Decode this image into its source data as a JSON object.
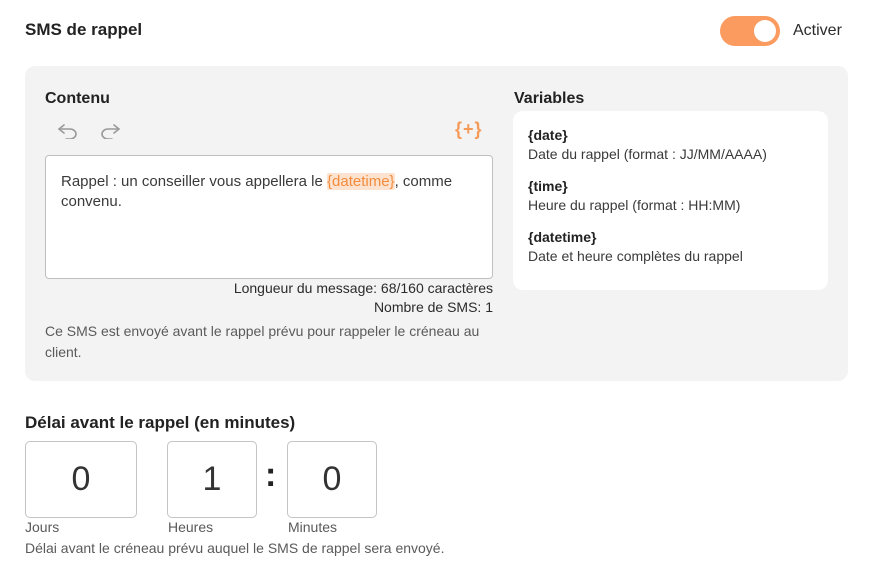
{
  "header": {
    "title": "SMS de rappel",
    "toggle_label": "Activer",
    "toggle_on": true,
    "accent_color": "#fb9b5f"
  },
  "content": {
    "title": "Contenu",
    "undo_icon": "undo-icon",
    "redo_icon": "redo-icon",
    "insert_variable_label": "{+}",
    "message_before": "Rappel : un conseiller vous appellera le ",
    "message_variable": "{datetime}",
    "message_after": ", comme convenu.",
    "length_text": "Longueur du message: 68/160 caractères",
    "sms_count_text": "Nombre de SMS: 1",
    "help_text": "Ce SMS est envoyé avant le rappel prévu pour rappeler le créneau au client."
  },
  "variables": {
    "title": "Variables",
    "items": [
      {
        "name": "{date}",
        "description": "Date du rappel (format : JJ/MM/AAAA)"
      },
      {
        "name": "{time}",
        "description": "Heure du rappel (format : HH:MM)"
      },
      {
        "name": "{datetime}",
        "description": "Date et heure complètes du rappel"
      }
    ]
  },
  "delay": {
    "title": "Délai avant le rappel (en minutes)",
    "days_value": "0",
    "hours_value": "1",
    "minutes_value": "0",
    "days_label": "Jours",
    "hours_label": "Heures",
    "minutes_label": "Minutes",
    "separator": ":",
    "help_text": "Délai avant le créneau prévu auquel le SMS de rappel sera envoyé."
  }
}
